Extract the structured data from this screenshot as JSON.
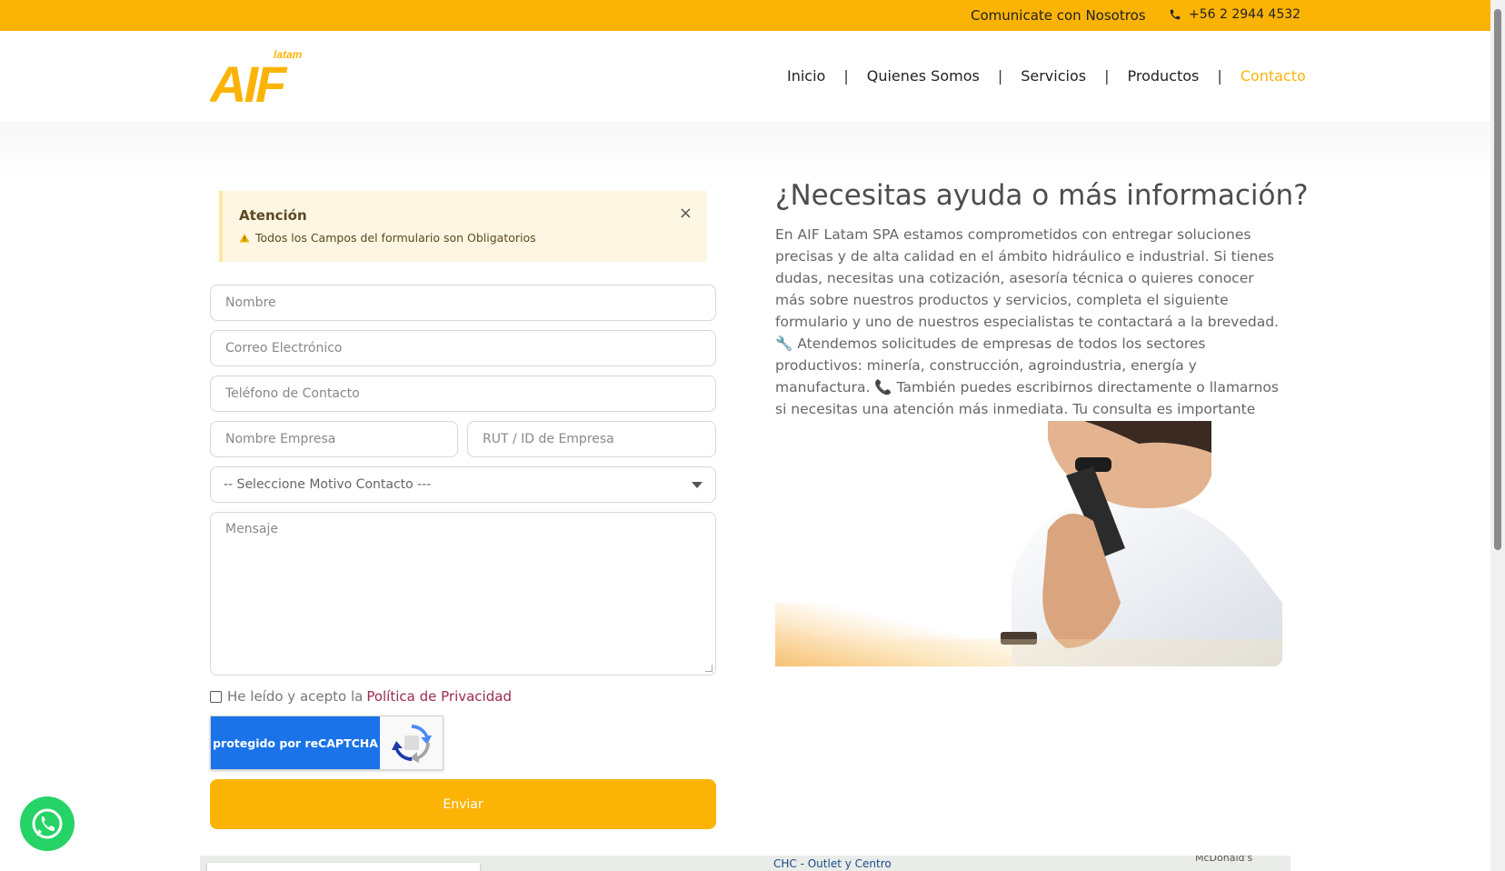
{
  "topbar": {
    "contact_label": "Comunicate con Nosotros",
    "phone": "+56 2 2944 4532"
  },
  "header": {
    "logo_text": "AIF",
    "logo_sub": "latam",
    "nav": [
      {
        "label": "Inicio"
      },
      {
        "label": "Quienes Somos"
      },
      {
        "label": "Servicios"
      },
      {
        "label": "Productos"
      },
      {
        "label": "Contacto",
        "active": true
      }
    ],
    "active_color": "#fbb406"
  },
  "alert": {
    "title": "Atención",
    "icon": "warning-icon",
    "message": "Todos los Campos del formulario son Obligatorios",
    "close_symbol": "×"
  },
  "form": {
    "nombre_placeholder": "Nombre",
    "correo_placeholder": "Correo Electrónico",
    "telefono_placeholder": "Teléfono de Contacto",
    "empresa_placeholder": "Nombre Empresa",
    "rut_placeholder": "RUT / ID de Empresa",
    "motivo_selected": "-- Seleccione Motivo Contacto ---",
    "mensaje_placeholder": "Mensaje",
    "consent_text": "He leído y acepto la ",
    "consent_link": "Política de Privacidad",
    "captcha_text": "protegido por reCAPTCHA",
    "submit_label": "Enviar"
  },
  "info": {
    "heading": "¿Necesitas ayuda o más información?",
    "paragraph_1": "En AIF Latam SPA estamos comprometidos con entregar soluciones precisas y de alta calidad en el ámbito hidráulico e industrial. Si tienes dudas, necesitas una cotización, asesoría técnica o quieres conocer más sobre nuestros productos y servicios, completa el siguiente formulario y uno de nuestros especialistas te contactará a la brevedad.",
    "emoji_1": "🔧",
    "paragraph_2": "Atendemos solicitudes de empresas de todos los sectores productivos: minería, construcción, agroindustria, energía y manufactura.",
    "emoji_2": "📞",
    "paragraph_3": "También puedes escribirnos directamente o llamarnos si necesitas una atención más inmediata. Tu consulta es importante para nosotros. ¡Gracias por confiar en AIF Latam!"
  },
  "map": {
    "place_label": "CHC - Outlet y Centro",
    "place_label_2": "McDonald's"
  },
  "colors": {
    "brand_yellow": "#fbb406",
    "captcha_blue": "#1a73e8",
    "whatsapp_green": "#25d366"
  }
}
